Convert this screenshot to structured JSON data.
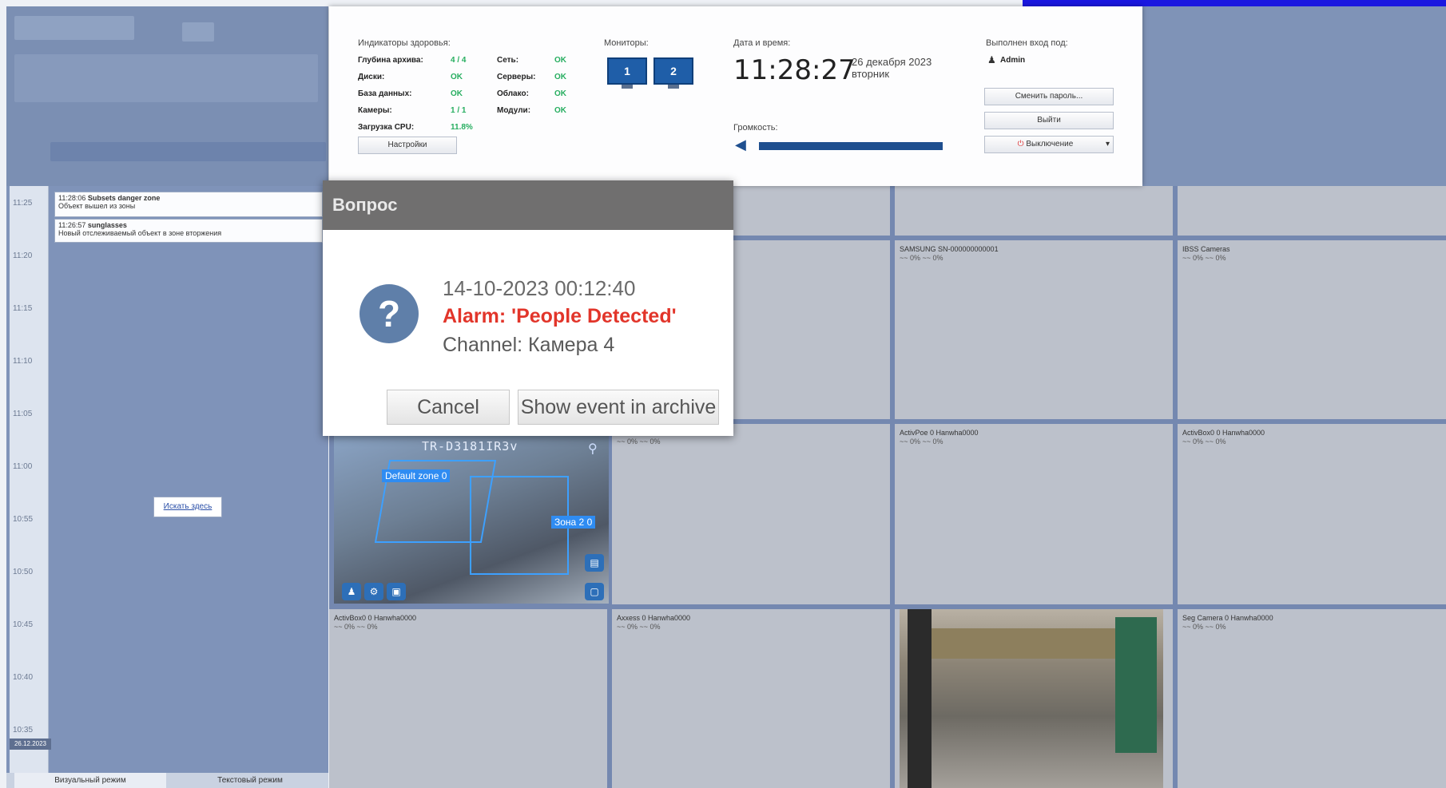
{
  "app": {
    "left_tabs": [
      "Визуальный режим",
      "Текстовый режим"
    ],
    "find_button": "Искать здесь",
    "date_badge": "26.12.2023"
  },
  "status_panel": {
    "health_title": "Индикаторы здоровья:",
    "health": [
      {
        "label": "Глубина архива:",
        "value": "4 / 4"
      },
      {
        "label": "Диски:",
        "value": "OK"
      },
      {
        "label": "База данных:",
        "value": "OK"
      },
      {
        "label": "Камеры:",
        "value": "1 / 1"
      },
      {
        "label": "Загрузка CPU:",
        "value": "11.8%"
      }
    ],
    "health2": [
      {
        "label": "Сеть:",
        "value": "OK"
      },
      {
        "label": "Серверы:",
        "value": "OK"
      },
      {
        "label": "Облако:",
        "value": "OK"
      },
      {
        "label": "Модули:",
        "value": "OK"
      }
    ],
    "settings_button": "Настройки",
    "monitors_title": "Мониторы:",
    "monitors": [
      "1",
      "2"
    ],
    "datetime_title": "Дата и время:",
    "time": "11:28:27",
    "date": "26 декабря 2023",
    "weekday": "вторник",
    "volume_title": "Громкость:",
    "volume_level": 1.0,
    "login_title": "Выполнен вход под:",
    "user": "Admin",
    "change_password_button": "Сменить пароль...",
    "logout_button": "Выйти",
    "shutdown_button": "Выключение"
  },
  "timeline": {
    "ticks": [
      "11:25",
      "11:20",
      "11:15",
      "11:10",
      "11:05",
      "11:00",
      "10:55",
      "10:50",
      "10:45",
      "10:40",
      "10:35"
    ]
  },
  "events": [
    {
      "time": "11:28:06",
      "title": "Subsets danger zone",
      "text": "Объект вышел из зоны"
    },
    {
      "time": "11:26:57",
      "title": "sunglasses",
      "text": "Новый отслеживаемый объект в зоне вторжения"
    }
  ],
  "dialog": {
    "title": "Вопрос",
    "datetime": "14-10-2023 00:12:40",
    "alarm": "Alarm: 'People Detected'",
    "channel": "Channel: Камера 4",
    "cancel_button": "Cancel",
    "archive_button": "Show event in archive"
  },
  "cameras": [
    {
      "name": "SAMSUNG SN-000000000001",
      "status": "~~ 0% ~~ 0%"
    },
    {
      "name": "IBSS Cameras",
      "status": "~~ 0% ~~ 0%"
    },
    {
      "name": "",
      "status": "~~ 0% ~~ 0%"
    },
    {
      "name": "ActivPoe 0 Hanwha0000",
      "status": "~~ 0% ~~ 0%"
    },
    {
      "name": "ActivBox0 0 Hanwha0000",
      "status": "~~ 0% ~~ 0%"
    },
    {
      "name": "ActivBox0 0 Hanwha0000",
      "status": "~~ 0% ~~ 0%"
    },
    {
      "name": "Axxess 0 Hanwha0000",
      "status": "~~ 0% ~~ 0%"
    },
    {
      "name": "Seg Camera 0 Hanwha0000",
      "status": "~~ 0% ~~ 0%"
    }
  ],
  "feed1": {
    "title": "TR-D3181IR3v",
    "zone_default": "Default zone 0",
    "zone2": "Зона 2 0"
  },
  "colors": {
    "accent_blue": "#1f4f8f",
    "alarm_red": "#e2352a",
    "ok_green": "#27ae60"
  }
}
